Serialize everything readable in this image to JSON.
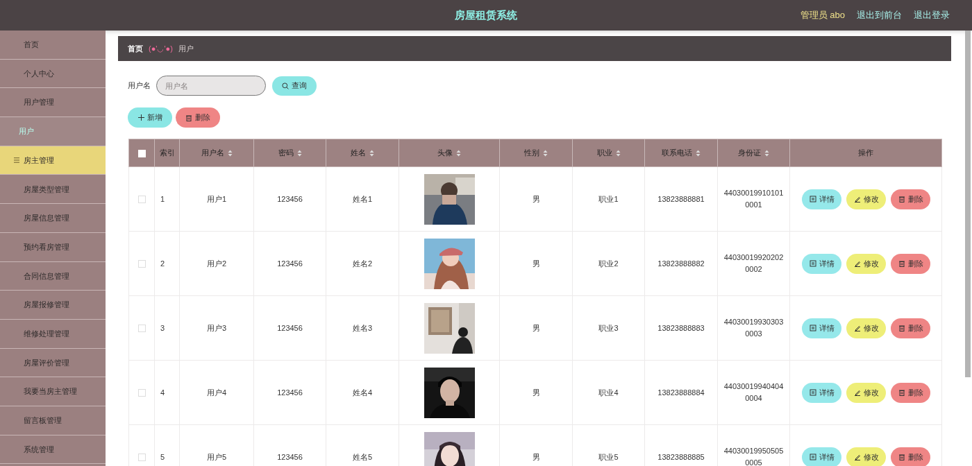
{
  "header": {
    "title": "房屋租赁系统",
    "user": "管理员 abo",
    "links": [
      "退出到前台",
      "退出登录"
    ]
  },
  "sidebar": {
    "items": [
      {
        "label": "首页",
        "kind": "menu",
        "selected": false,
        "hovered": false
      },
      {
        "label": "个人中心",
        "kind": "menu",
        "selected": false,
        "hovered": false
      },
      {
        "label": "用户管理",
        "kind": "menu",
        "selected": false,
        "hovered": false
      },
      {
        "label": "用户",
        "kind": "submenu",
        "selected": true,
        "hovered": false
      },
      {
        "label": "房主管理",
        "kind": "menu",
        "selected": false,
        "hovered": true
      },
      {
        "label": "房屋类型管理",
        "kind": "menu",
        "selected": false,
        "hovered": false
      },
      {
        "label": "房屋信息管理",
        "kind": "menu",
        "selected": false,
        "hovered": false
      },
      {
        "label": "预约看房管理",
        "kind": "menu",
        "selected": false,
        "hovered": false
      },
      {
        "label": "合同信息管理",
        "kind": "menu",
        "selected": false,
        "hovered": false
      },
      {
        "label": "房屋报修管理",
        "kind": "menu",
        "selected": false,
        "hovered": false
      },
      {
        "label": "维修处理管理",
        "kind": "menu",
        "selected": false,
        "hovered": false
      },
      {
        "label": "房屋评价管理",
        "kind": "menu",
        "selected": false,
        "hovered": false
      },
      {
        "label": "我要当房主管理",
        "kind": "menu",
        "selected": false,
        "hovered": false
      },
      {
        "label": "留言板管理",
        "kind": "menu",
        "selected": false,
        "hovered": false
      },
      {
        "label": "系统管理",
        "kind": "menu",
        "selected": false,
        "hovered": false
      }
    ]
  },
  "breadcrumb": {
    "home": "首页",
    "separator": "(●'◡'●)",
    "current": "用户"
  },
  "search": {
    "label": "用户名",
    "placeholder": "用户名",
    "button": "查询"
  },
  "actions": {
    "add": "新增",
    "delete": "删除"
  },
  "table": {
    "columns": [
      {
        "label": "索引",
        "sortable": false
      },
      {
        "label": "用户名",
        "sortable": true
      },
      {
        "label": "密码",
        "sortable": true
      },
      {
        "label": "姓名",
        "sortable": true
      },
      {
        "label": "头像",
        "sortable": true
      },
      {
        "label": "性别",
        "sortable": true
      },
      {
        "label": "职业",
        "sortable": true
      },
      {
        "label": "联系电话",
        "sortable": true
      },
      {
        "label": "身份证",
        "sortable": true
      },
      {
        "label": "操作",
        "sortable": false
      }
    ],
    "all_checked": false,
    "rows": [
      {
        "checked": false,
        "index": "1",
        "username": "用户1",
        "password": "123456",
        "name": "姓名1",
        "gender": "男",
        "job": "职业1",
        "phone": "13823888881",
        "id_card": "440300199101010001",
        "buttons": [
          "详情",
          "修改",
          "删除"
        ]
      },
      {
        "checked": false,
        "index": "2",
        "username": "用户2",
        "password": "123456",
        "name": "姓名2",
        "gender": "男",
        "job": "职业2",
        "phone": "13823888882",
        "id_card": "440300199202020002",
        "buttons": [
          "详情",
          "修改",
          "删除"
        ]
      },
      {
        "checked": false,
        "index": "3",
        "username": "用户3",
        "password": "123456",
        "name": "姓名3",
        "gender": "男",
        "job": "职业3",
        "phone": "13823888883",
        "id_card": "440300199303030003",
        "buttons": [
          "详情",
          "修改",
          "删除"
        ]
      },
      {
        "checked": false,
        "index": "4",
        "username": "用户4",
        "password": "123456",
        "name": "姓名4",
        "gender": "男",
        "job": "职业4",
        "phone": "13823888884",
        "id_card": "440300199404040004",
        "buttons": [
          "详情",
          "修改",
          "删除"
        ]
      },
      {
        "checked": false,
        "index": "5",
        "username": "用户5",
        "password": "123456",
        "name": "姓名5",
        "gender": "男",
        "job": "职业5",
        "phone": "13823888885",
        "id_card": "440300199505050005",
        "buttons": [
          "详情",
          "修改",
          "删除"
        ]
      }
    ]
  }
}
